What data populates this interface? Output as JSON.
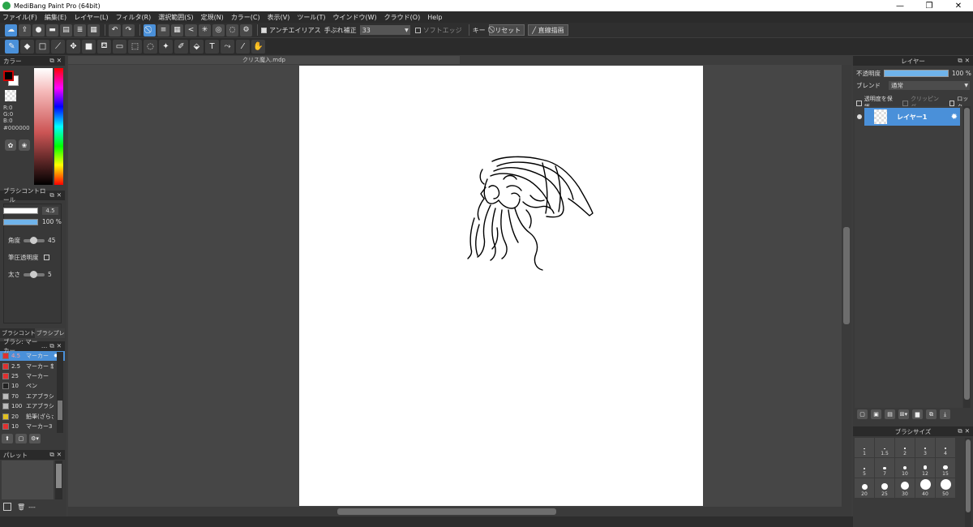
{
  "window": {
    "title": "MediBang Paint Pro (64bit)",
    "min": "—",
    "max": "❐",
    "close": "✕"
  },
  "menu": [
    "ファイル(F)",
    "編集(E)",
    "レイヤー(L)",
    "フィルタ(R)",
    "選択範囲(S)",
    "定規(N)",
    "カラー(C)",
    "表示(V)",
    "ツール(T)",
    "ウインドウ(W)",
    "クラウド(O)",
    "Help"
  ],
  "toolbar1": {
    "antialias_label": "アンチエイリアス",
    "stabilizer_label": "手ぶれ補正",
    "stabilizer_value": "33",
    "soft_edge_label": "ソフトエッジ",
    "key_label": "キー",
    "reset_label": "リセット",
    "line_label": "直線描画"
  },
  "document": {
    "tab": "クリス魔入.mdp"
  },
  "color_panel": {
    "title": "カラー",
    "r": "R:0",
    "g": "G:0",
    "b": "B:0",
    "hex": "#000000"
  },
  "brush_control": {
    "title": "ブラシコントロール",
    "size_value": "4.5",
    "opacity_value": "100 %",
    "angle_label": "角度",
    "angle_value": "45",
    "pressure_opacity_label": "筆圧透明度",
    "thickness_label": "太さ",
    "thickness_value": "5"
  },
  "tabs": [
    "ブラシコント…",
    "ブラシプレ…"
  ],
  "brush_list": {
    "header": "ブラシ: マーカー",
    "items": [
      {
        "size": "4.5",
        "name": "マーカー",
        "color": "#e03030",
        "selected": true
      },
      {
        "size": "2.5",
        "name": "マーカー 新",
        "color": "#e03030"
      },
      {
        "size": "25",
        "name": "マーカー",
        "color": "#e03030"
      },
      {
        "size": "10",
        "name": "ペン",
        "color": "#222222"
      },
      {
        "size": "70",
        "name": "エアブラシ(",
        "color": "#bbbbbb"
      },
      {
        "size": "100",
        "name": "エアブラシ(",
        "color": "#bbbbbb"
      },
      {
        "size": "20",
        "name": "鉛筆(ざらざ",
        "color": "#e0c020"
      },
      {
        "size": "10",
        "name": "マーカー3",
        "color": "#e03030"
      }
    ]
  },
  "palette": {
    "title": "パレット",
    "footer": "---"
  },
  "layer_panel": {
    "title": "レイヤー",
    "opacity_label": "不透明度",
    "opacity_value": "100 %",
    "blend_label": "ブレンド",
    "blend_value": "通常",
    "protect_alpha_label": "透明度を保護",
    "clipping_label": "クリッピング",
    "lock_label": "ロック",
    "layer_name": "レイヤー1"
  },
  "brush_size": {
    "title": "ブラシサイズ",
    "sizes": [
      "1",
      "1.5",
      "2",
      "3",
      "4",
      "5",
      "7",
      "10",
      "12",
      "15",
      "20",
      "25",
      "30",
      "40",
      "50"
    ]
  }
}
